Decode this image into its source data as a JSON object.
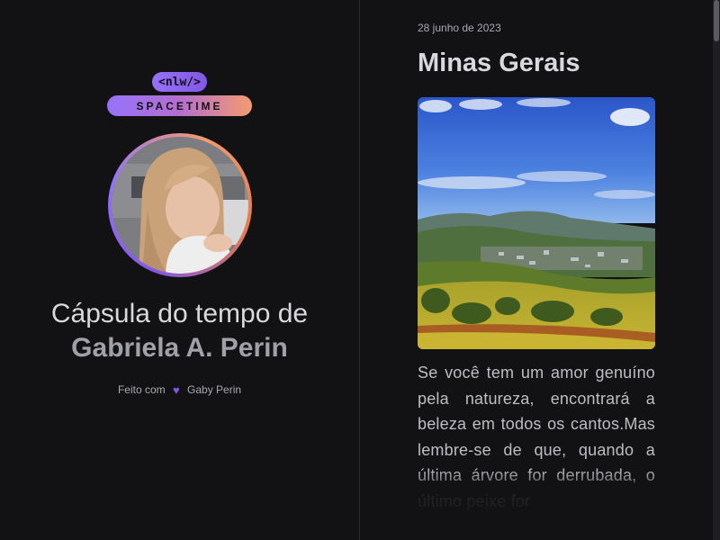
{
  "logo": {
    "tag": "<nlw/>",
    "wordmark": "SPACETIME"
  },
  "profile": {
    "title_line1": "Cápsula do tempo de",
    "title_line2": "Gabriela A. Perin",
    "credit_prefix": "Feito com",
    "credit_icon": "heart-icon",
    "credit_author": "Gaby Perin"
  },
  "memory": {
    "date": "28 junho de 2023",
    "title": "Minas Gerais",
    "text": "Se você tem um amor genuíno pela natureza, encontrará a beleza em todos os cantos.Mas lembre-se de que, quando a última árvore for derrubada, o último peixe for"
  },
  "colors": {
    "background": "#121215",
    "accent_purple": "#8257e5",
    "accent_orange": "#f49b6f"
  }
}
